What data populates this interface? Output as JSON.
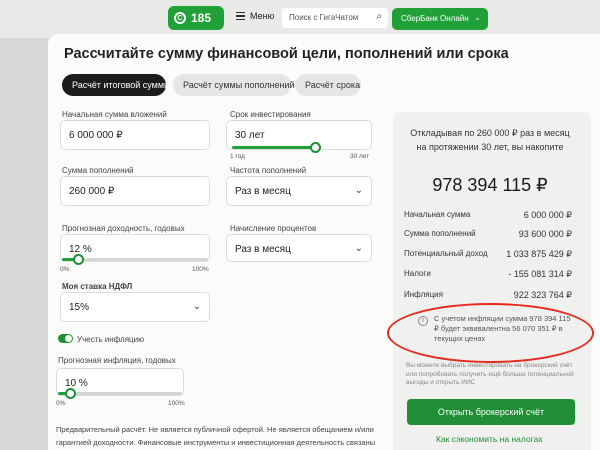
{
  "header": {
    "logo_text": "185",
    "logo_mark": "С",
    "menu_label": "Меню",
    "search_placeholder": "Поиск с ГигаЧатом",
    "online_button": "СберБанк Онлайн"
  },
  "calc": {
    "title": "Рассчитайте сумму финансовой цели, пополнений или срока",
    "tabs": [
      "Расчёт итоговой суммы",
      "Расчёт суммы пополнений",
      "Расчёт срока"
    ],
    "active_tab": 0
  },
  "fields": {
    "initial": {
      "label": "Начальная сумма вложений",
      "value": "6 000 000 ₽"
    },
    "term": {
      "label": "Срок инвестирования",
      "value": "30 лет",
      "min_label": "1 год",
      "max_label": "30 лет",
      "slider_fraction": 1.0
    },
    "topup": {
      "label": "Сумма пополнений",
      "value": "260 000 ₽"
    },
    "frequency": {
      "label": "Частота пополнений",
      "value": "Раз в месяц"
    },
    "yield": {
      "label": "Прогнозная доходность, годовых",
      "value": "12 %",
      "min_label": "0%",
      "max_label": "100%",
      "slider_fraction": 0.12
    },
    "accrual": {
      "label": "Начисление процентов",
      "value": "Раз в месяц"
    },
    "ndfl": {
      "label": "Моя ставка НДФЛ",
      "value": "15%"
    },
    "inflation_toggle": {
      "label": "Учесть инфляцию",
      "on": true
    },
    "inflation": {
      "label": "Прогнозная инфляция, годовых",
      "value": "10 %",
      "min_label": "0%",
      "max_label": "100%",
      "slider_fraction": 0.1
    }
  },
  "disclaimer": "Предварительный расчёт. Не является публичной офертой. Не является обещанием и/или гарантией доходности. Финансовые инструменты и инвестиционная деятельность связаны с",
  "result": {
    "heading": "Откладывая по 260 000 ₽ раз в месяц на протяжении 30 лет, вы накопите",
    "total": "978 394 115 ₽",
    "rows": [
      {
        "label": "Начальная сумма",
        "value": "6 000 000 ₽"
      },
      {
        "label": "Сумма пополнений",
        "value": "93 600 000 ₽"
      },
      {
        "label": "Потенциальный доход",
        "value": "1 033 875 429 ₽"
      },
      {
        "label": "Налоги",
        "value": "- 155 081 314 ₽"
      },
      {
        "label": "Инфляция",
        "value": "922 323 764 ₽"
      }
    ],
    "inflation_note": "С учетом инфляции сумма 978 394 115 ₽ будет эквивалентна 56 070 351 ₽ в текущих ценах",
    "faint_text": "Вы можете выбрать инвестировать на брокерский счёт или попробовать получить ещё больше потенциальной выгоды и открыть ИИС",
    "open_button": "Открыть брокерский счёт",
    "contact_link": "Как сэкономить на налогах"
  },
  "colors": {
    "brand_green": "#21a038",
    "annotation_red": "#e52a1e"
  }
}
